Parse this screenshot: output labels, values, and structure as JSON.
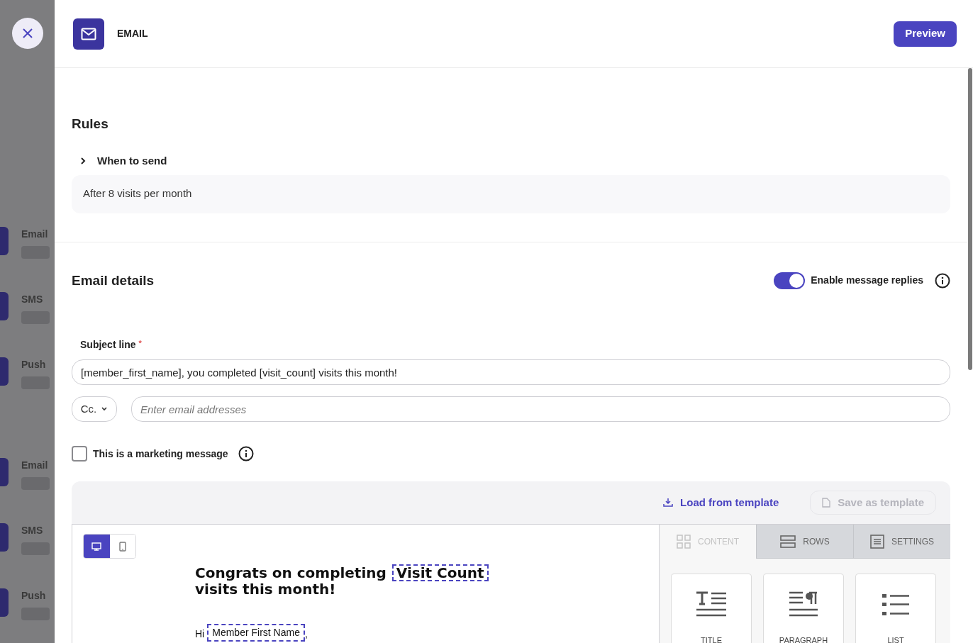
{
  "backdrop": {
    "items": [
      {
        "label": "Email"
      },
      {
        "label": "SMS"
      },
      {
        "label": "Push"
      },
      {
        "label": "Email"
      },
      {
        "label": "SMS"
      },
      {
        "label": "Push"
      }
    ]
  },
  "header": {
    "title": "EMAIL",
    "preview_button": "Preview"
  },
  "rules": {
    "heading": "Rules",
    "expander": {
      "label": "When to send",
      "expanded": false
    },
    "summary": "After 8 visits per month"
  },
  "email_details": {
    "heading": "Email details",
    "replies_toggle": {
      "label": "Enable message replies",
      "on": true
    },
    "subject": {
      "label": "Subject line",
      "required_mark": "*",
      "value": "[member_first_name], you completed [visit_count] visits this month!"
    },
    "cc": {
      "label": "Cc.",
      "placeholder": "Enter email addresses"
    },
    "marketing": {
      "label": "This is a marketing message",
      "checked": false
    }
  },
  "editor": {
    "toolbar": [
      {
        "label": "Load from template",
        "kind": "load",
        "disabled": false
      },
      {
        "label": "Save as template",
        "kind": "save",
        "disabled": true
      }
    ],
    "devices": [
      {
        "kind": "desktop",
        "selected": true
      },
      {
        "kind": "mobile",
        "selected": false
      }
    ],
    "email": {
      "heading": {
        "before": "Congrats on completing",
        "token": "Visit Count",
        "after": "visits this month!"
      },
      "greeting": {
        "before": "Hi",
        "token": "Member First Name",
        "after": ","
      }
    },
    "tabs": [
      {
        "label": "CONTENT",
        "kind": "content",
        "selected": true
      },
      {
        "label": "ROWS",
        "kind": "rows",
        "selected": false
      },
      {
        "label": "SETTINGS",
        "kind": "settings",
        "selected": false
      }
    ],
    "blocks": [
      {
        "label": "TITLE",
        "kind": "title"
      },
      {
        "label": "PARAGRAPH",
        "kind": "paragraph"
      },
      {
        "label": "LIST",
        "kind": "list"
      }
    ]
  }
}
